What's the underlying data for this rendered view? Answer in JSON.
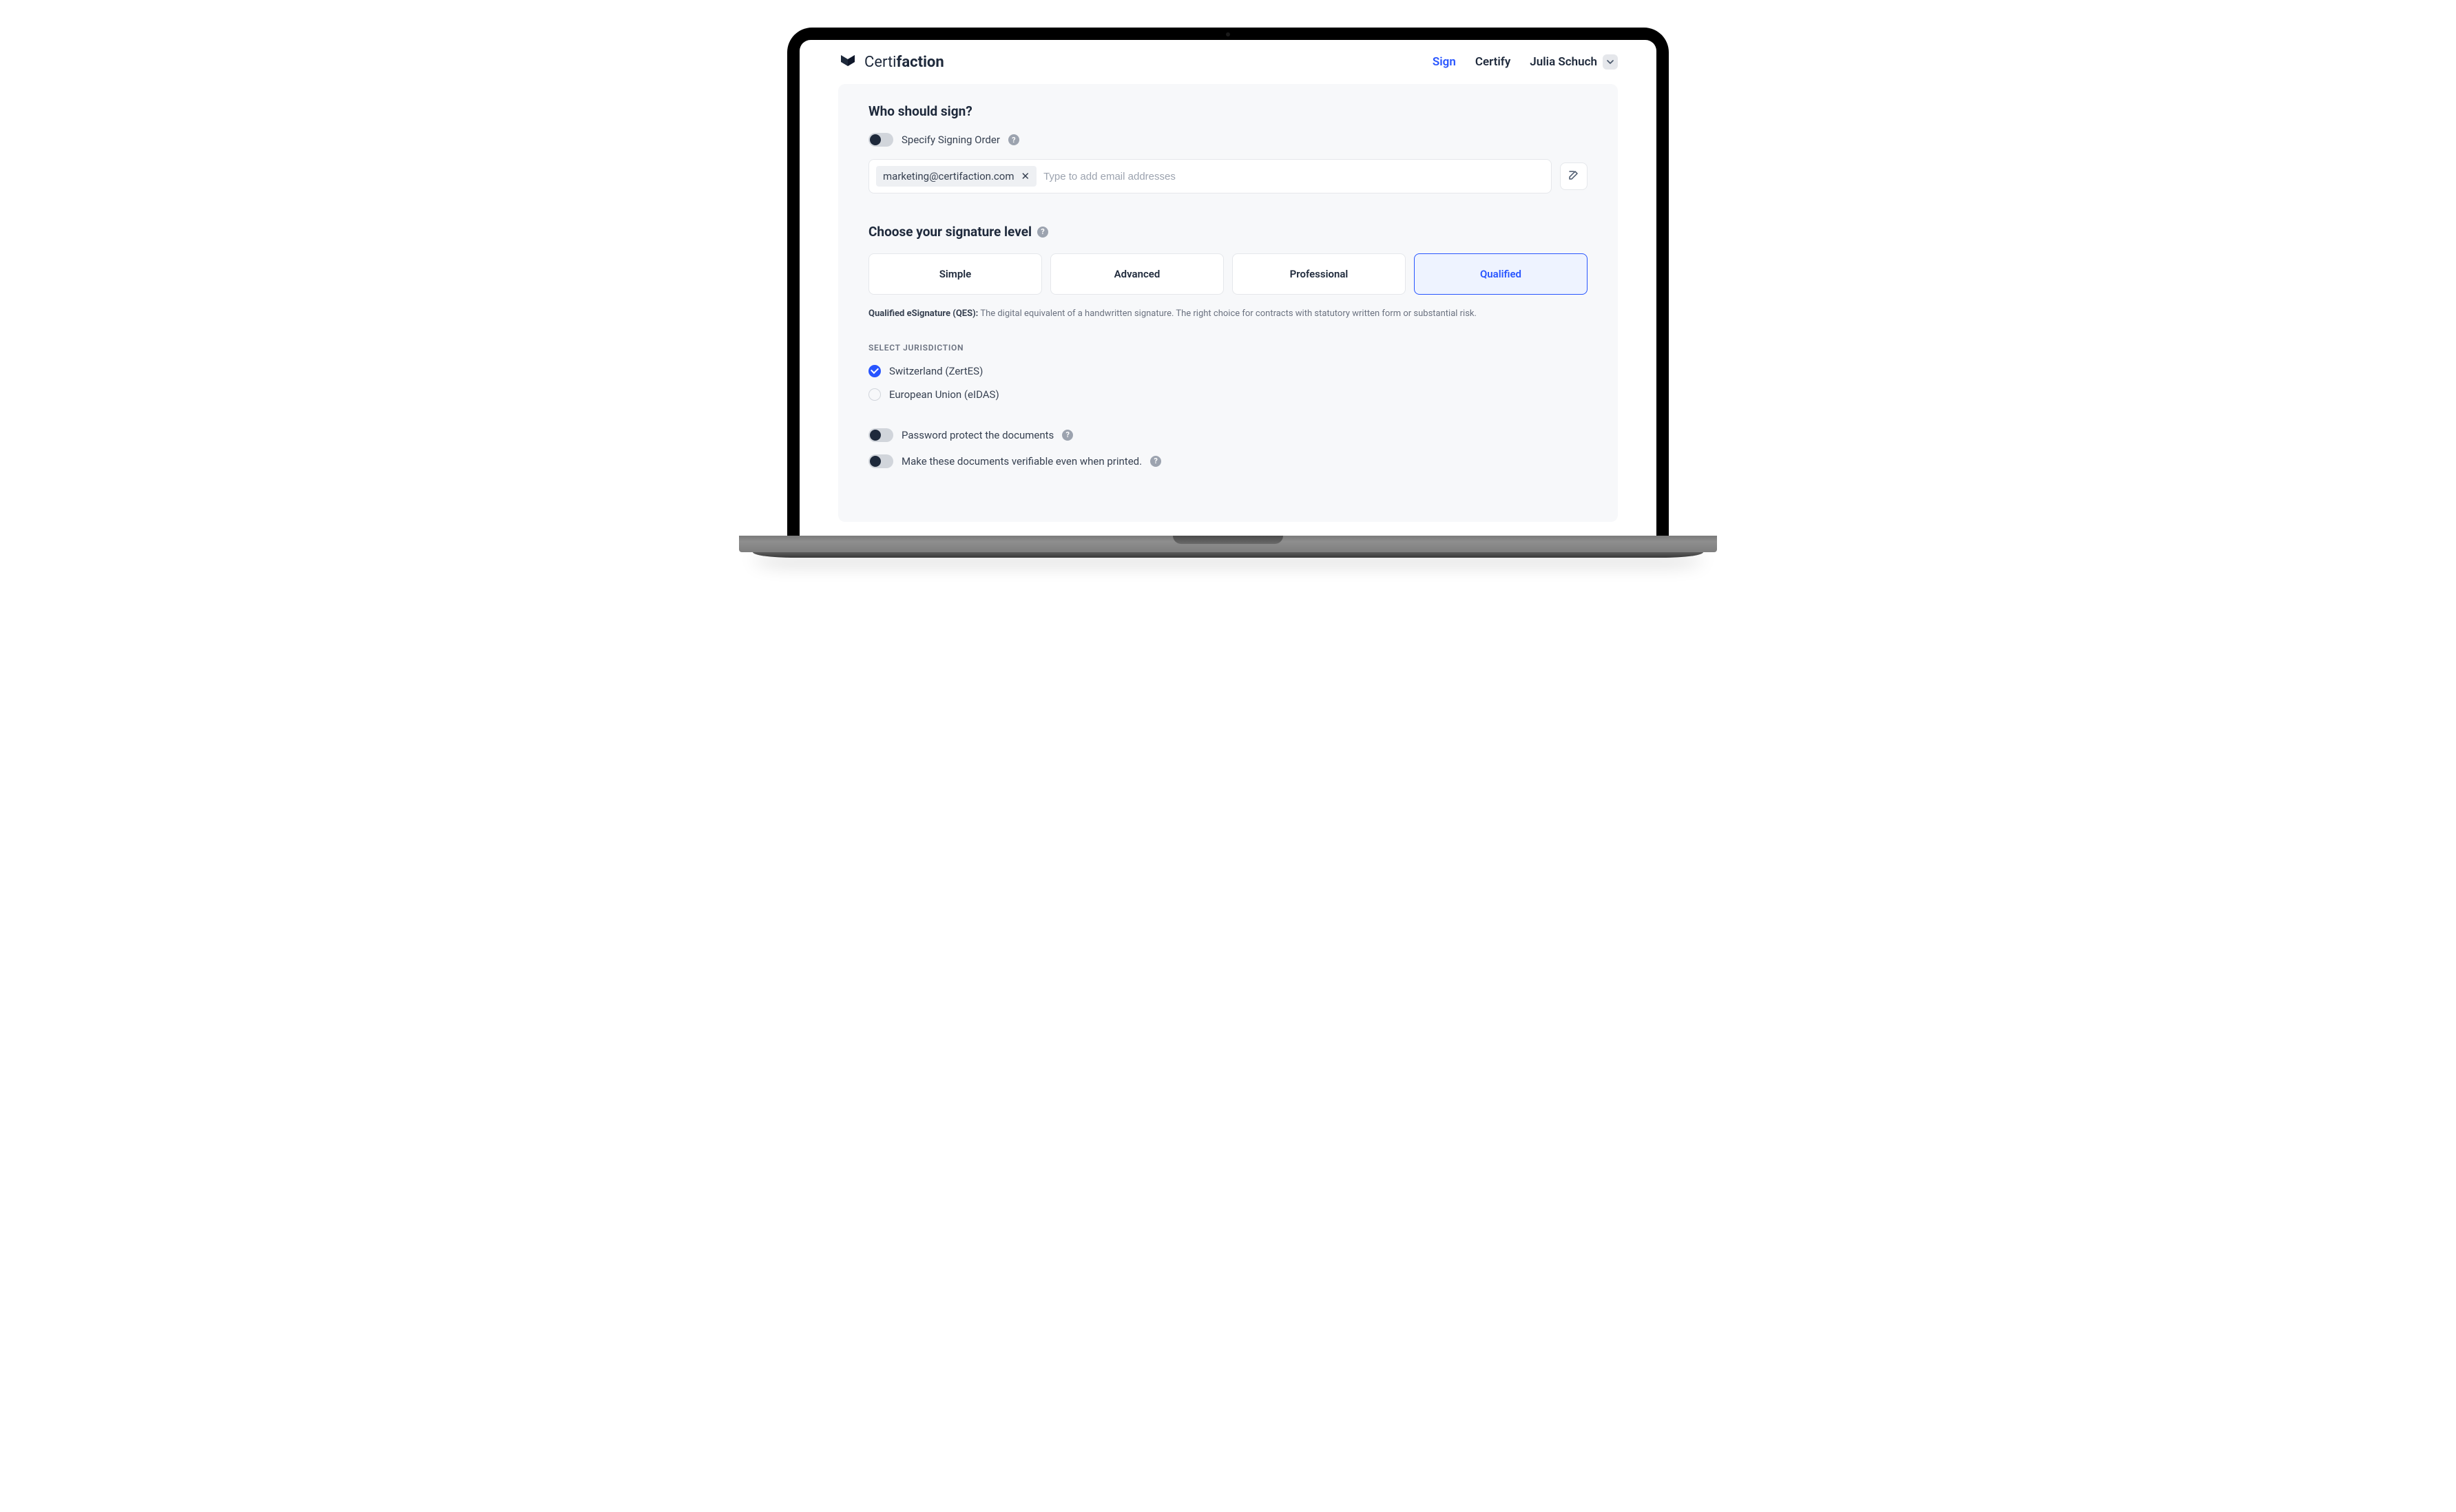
{
  "header": {
    "brand_thin": "Certi",
    "brand_bold": "faction",
    "nav": {
      "sign": "Sign",
      "certify": "Certify"
    },
    "user_name": "Julia Schuch"
  },
  "signers": {
    "title": "Who should sign?",
    "specify_order_label": "Specify Signing Order",
    "chip_email": "marketing@certifaction.com",
    "input_placeholder": "Type to add email addresses"
  },
  "levels": {
    "title": "Choose your signature level",
    "options": {
      "simple": "Simple",
      "advanced": "Advanced",
      "professional": "Professional",
      "qualified": "Qualified"
    },
    "desc_strong": "Qualified eSignature (QES):",
    "desc_text": " The digital equivalent of a handwritten signature. The right choice for contracts with statutory written form or substantial risk."
  },
  "jurisdiction": {
    "subhead": "SELECT JURISDICTION",
    "switzerland": "Switzerland (ZertES)",
    "eu": "European Union (eIDAS)"
  },
  "options": {
    "password_protect": "Password protect the documents",
    "verifiable_printed": "Make these documents verifiable even when printed."
  }
}
